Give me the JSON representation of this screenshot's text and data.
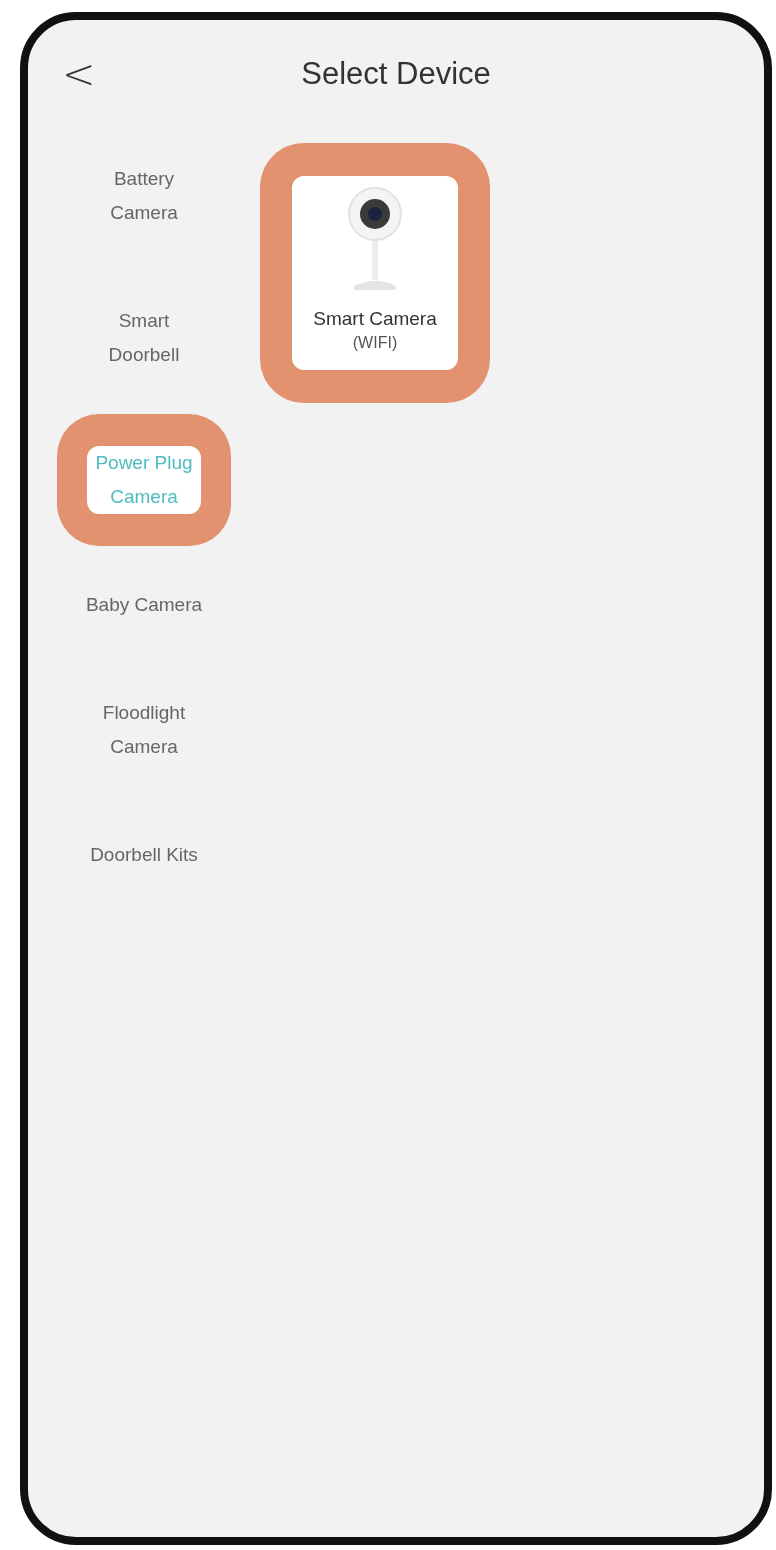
{
  "header": {
    "back": "<",
    "title": "Select Device"
  },
  "categories": [
    {
      "label": "Battery\nCamera",
      "selected": false,
      "highlighted": false
    },
    {
      "label": "Smart\nDoorbell",
      "selected": false,
      "highlighted": false
    },
    {
      "label": "Power Plug\nCamera",
      "selected": true,
      "highlighted": true
    },
    {
      "label": "Baby Camera",
      "selected": false,
      "highlighted": false
    },
    {
      "label": "Floodlight\nCamera",
      "selected": false,
      "highlighted": false
    },
    {
      "label": "Doorbell Kits",
      "selected": false,
      "highlighted": false
    }
  ],
  "devices": [
    {
      "name": "Smart Camera",
      "subtitle": "(WIFI)",
      "highlighted": true
    }
  ]
}
